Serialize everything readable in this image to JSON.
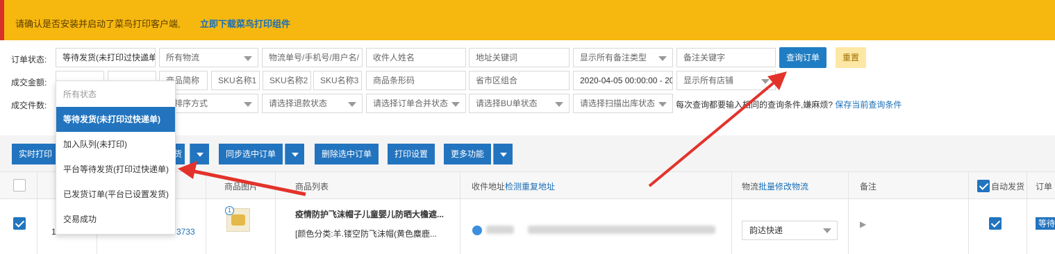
{
  "banner": {
    "text": "请确认是否安装并启动了菜鸟打印客户端,",
    "link": "立即下载菜鸟打印组件"
  },
  "filters": {
    "labels": [
      "订单状态:",
      "成交金额:",
      "成交件数:"
    ],
    "row1": [
      "等待发货(未打印过快递单)",
      "所有物流",
      "物流单号/手机号/用户名/",
      "收件人姓名",
      "地址关键词",
      "显示所有备注类型",
      "备注关键字"
    ],
    "row2": [
      "商品简称",
      "SKU名称1",
      "SKU名称2",
      "SKU名称3",
      "商品条形码",
      "省市区组合",
      "2020-04-05 00:00:00 - 20",
      "显示所有店铺"
    ],
    "row3": [
      "单排序方式",
      "请选择退款状态",
      "请选择订单合并状态",
      "请选择BU单状态",
      "请选择扫描出库状态"
    ],
    "query_button": "查询订单",
    "reset_button": "重置",
    "hint": "每次查询都要输入相同的查询条件,嫌麻烦?",
    "hint_link": "保存当前查询条件"
  },
  "toolbar": {
    "realtime": "实时打印",
    "ship_partial": "货",
    "sync": "同步选中订单",
    "delete": "删除选中订单",
    "print_settings": "打印设置",
    "more": "更多功能"
  },
  "table": {
    "headers": {
      "image": "商品图片",
      "products": "商品列表",
      "address": "收件地址",
      "address_link": "检测重复地址",
      "logistics": "物流",
      "logistics_link": "批量修改物流",
      "notes": "备注",
      "auto_ship": "自动发货",
      "order": "订单"
    },
    "row": {
      "row_number": "1",
      "order_number": "3733",
      "qty": "1",
      "product_name": "疫情防护飞沫帽子儿童婴儿防晒大檐遮...",
      "product_spec": "[颜色分类:羊.镂空防飞沫帽(黄色麋鹿...",
      "shipping": "韵达快递",
      "flag": "▶",
      "status": "等待"
    }
  },
  "dropdown": {
    "items": [
      "所有状态",
      "等待发货(未打印过快递单)",
      "加入队列(未打印)",
      "平台等待发货(打印过快递单)",
      "已发货订单(平台已设置发货)",
      "交易成功"
    ],
    "selected_index": 1
  },
  "colors": {
    "banner": "#f6b80f",
    "primary": "#2274bf",
    "arrow": "#e2332b"
  }
}
